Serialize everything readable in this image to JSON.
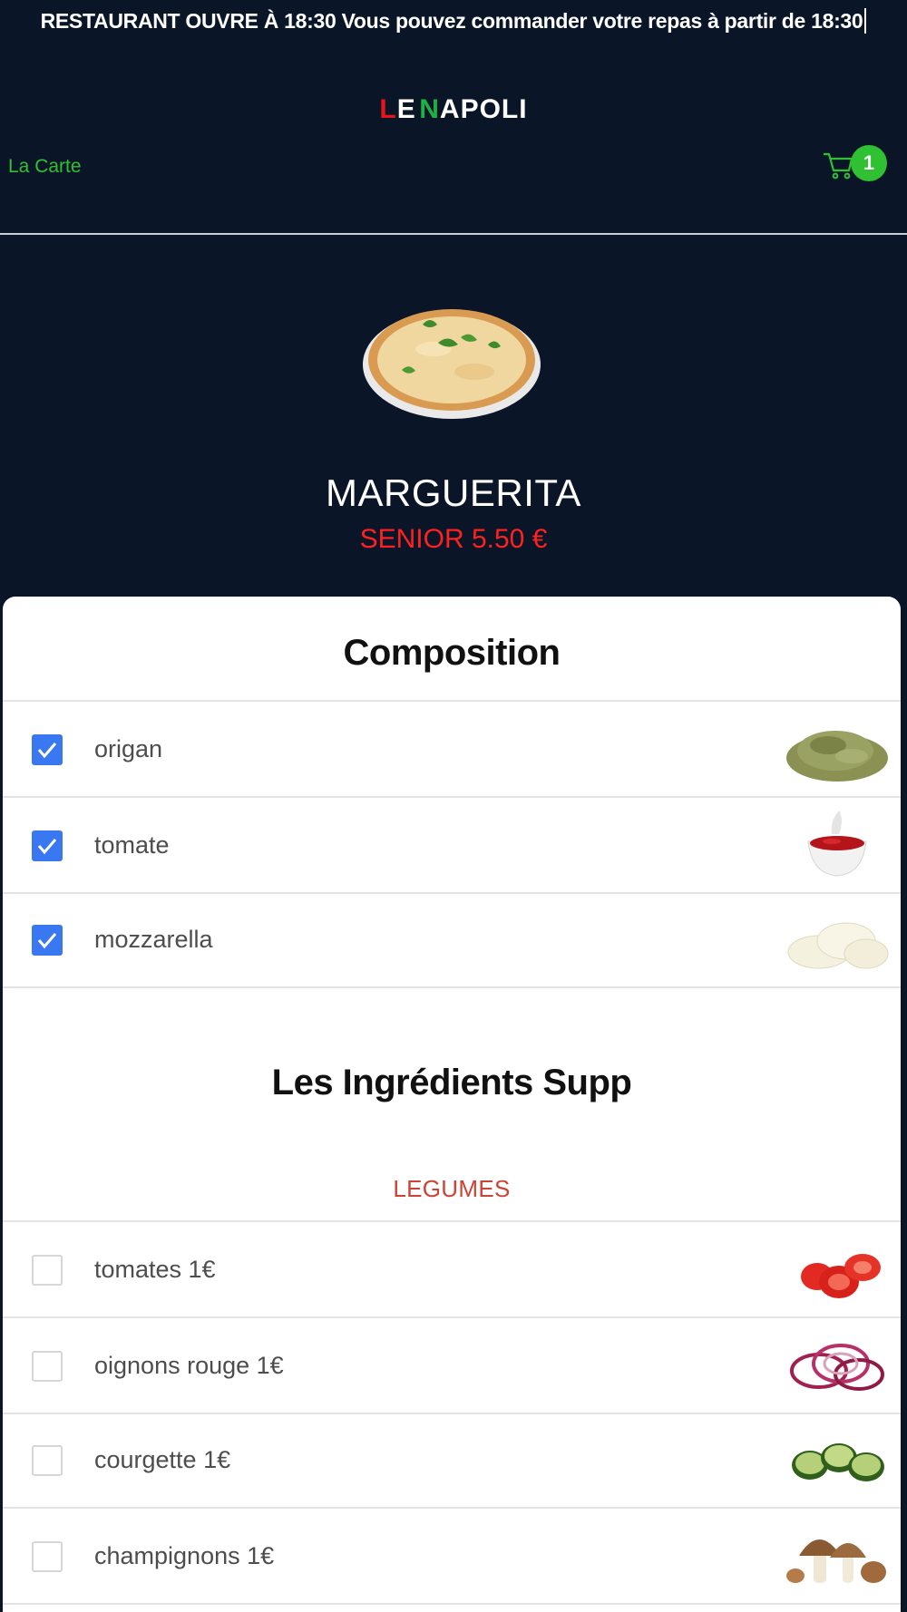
{
  "banner": {
    "text": "RESTAURANT OUVRE À 18:30 Vous pouvez commander votre repas à partir de 18:30"
  },
  "logo": {
    "le_l": "L",
    "le_e": "E",
    "napoli_n": "N",
    "napoli_rest": "APOLI"
  },
  "nav": {
    "menu_link": "La Carte",
    "cart_count": "1"
  },
  "product": {
    "name": "MARGUERITA",
    "price": "SENIOR 5.50 €"
  },
  "composition": {
    "title": "Composition",
    "items": [
      {
        "label": "origan",
        "checked": true,
        "icon": "oregano-icon"
      },
      {
        "label": "tomate",
        "checked": true,
        "icon": "tomato-sauce-icon"
      },
      {
        "label": "mozzarella",
        "checked": true,
        "icon": "mozzarella-icon"
      }
    ]
  },
  "extras": {
    "title": "Les Ingrédients Supp",
    "category": "LEGUMES",
    "items": [
      {
        "label": "tomates 1€",
        "checked": false,
        "icon": "tomato-slices-icon"
      },
      {
        "label": "oignons rouge 1€",
        "checked": false,
        "icon": "red-onion-icon"
      },
      {
        "label": "courgette 1€",
        "checked": false,
        "icon": "zucchini-icon"
      },
      {
        "label": "champignons 1€",
        "checked": false,
        "icon": "mushrooms-icon"
      }
    ]
  },
  "colors": {
    "background": "#0a1628",
    "accent_green": "#2fc132",
    "price_red": "#ff2020",
    "checkbox_blue": "#3a78f2",
    "category_red": "#cc4433"
  }
}
